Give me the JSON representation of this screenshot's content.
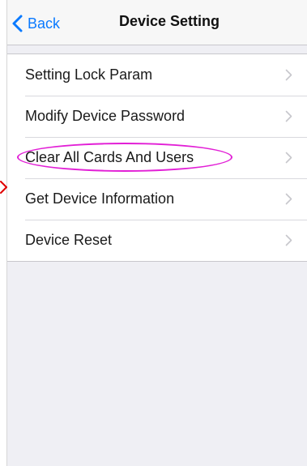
{
  "nav": {
    "back_label": "Back",
    "title": "Device Setting"
  },
  "menu": {
    "items": [
      {
        "label": "Setting Lock Param"
      },
      {
        "label": "Modify Device Password"
      },
      {
        "label": "Clear All Cards And Users",
        "highlighted": true
      },
      {
        "label": "Get Device Information"
      },
      {
        "label": "Device Reset"
      }
    ]
  },
  "colors": {
    "accent": "#0a7aff",
    "highlight": "#e21fd6",
    "arrow": "#e00000",
    "background": "#efeff4"
  },
  "icons": {
    "back": "chevron-left-icon",
    "disclosure": "chevron-right-icon"
  }
}
